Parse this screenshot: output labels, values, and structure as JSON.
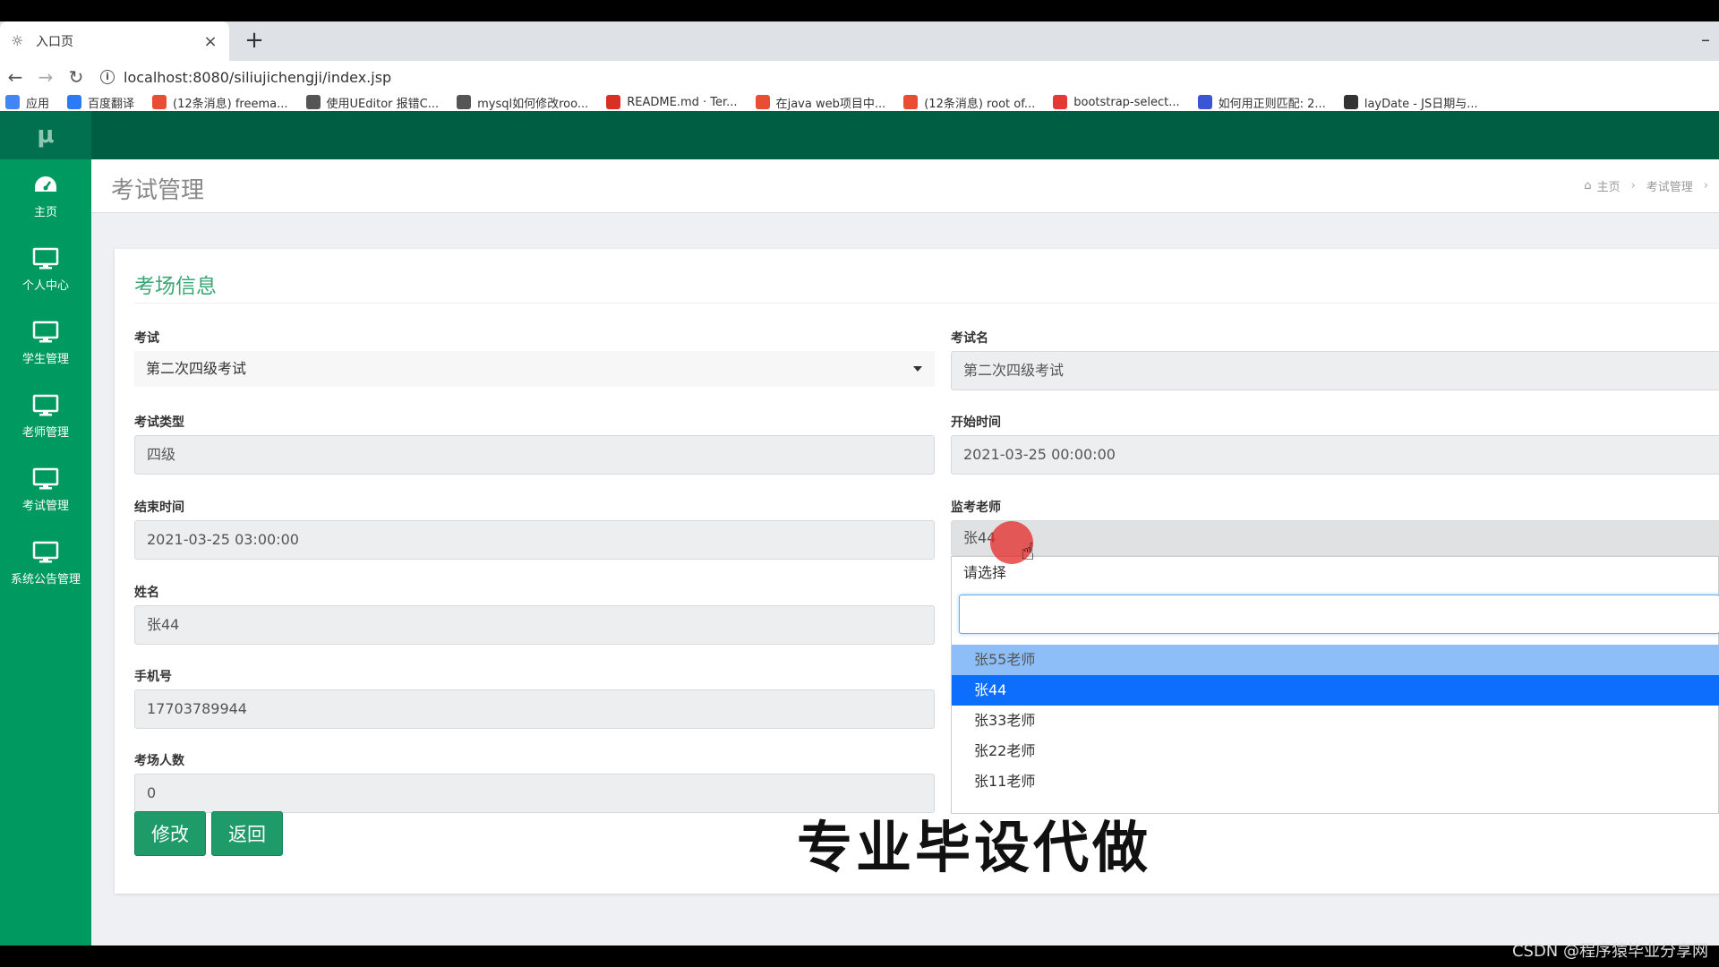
{
  "browser": {
    "tab_title": "入口页",
    "url": "localhost:8080/siliujichengji/index.jsp",
    "bookmarks": [
      {
        "label": "应用",
        "color": "#4285f4"
      },
      {
        "label": "百度翻译",
        "color": "#2b7bf7"
      },
      {
        "label": "(12条消息) freema...",
        "color": "#e94d33"
      },
      {
        "label": "使用UEditor 报错C...",
        "color": "#555555"
      },
      {
        "label": "mysql如何修改roo...",
        "color": "#555555"
      },
      {
        "label": "README.md · Ter...",
        "color": "#d93025"
      },
      {
        "label": "在java web项目中...",
        "color": "#e94d33"
      },
      {
        "label": "(12条消息) root of...",
        "color": "#e94d33"
      },
      {
        "label": "bootstrap-select...",
        "color": "#e53935"
      },
      {
        "label": "如何用正则匹配: 2...",
        "color": "#3a56d4"
      },
      {
        "label": "layDate - JS日期与...",
        "color": "#333333"
      }
    ]
  },
  "app": {
    "logo": "μ",
    "sidebar": [
      {
        "label": "主页"
      },
      {
        "label": "个人中心"
      },
      {
        "label": "学生管理"
      },
      {
        "label": "老师管理"
      },
      {
        "label": "考试管理"
      },
      {
        "label": "系统公告管理"
      }
    ],
    "page_title": "考试管理",
    "breadcrumb": {
      "home": "主页",
      "current": "考试管理"
    }
  },
  "form": {
    "title": "考场信息",
    "exam_label": "考试",
    "exam_value": "第二次四级考试",
    "exam_name_label": "考试名",
    "exam_name_value": "第二次四级考试",
    "exam_type_label": "考试类型",
    "exam_type_value": "四级",
    "start_time_label": "开始时间",
    "start_time_value": "2021-03-25 00:00:00",
    "end_time_label": "结束时间",
    "end_time_value": "2021-03-25 03:00:00",
    "teacher_label": "监考老师",
    "teacher_value": "张44",
    "name_label": "姓名",
    "name_value": "张44",
    "phone_label": "手机号",
    "phone_value": "17703789944",
    "count_label": "考场人数",
    "count_value": "0",
    "dropdown": {
      "header": "请选择",
      "options": [
        "张55老师",
        "张44",
        "张33老师",
        "张22老师",
        "张11老师"
      ],
      "hover_index": 0,
      "selected_index": 1
    },
    "edit_button": "修改",
    "back_button": "返回"
  },
  "overlay": {
    "bottom_text": "专业毕设代做",
    "watermark": "CSDN @程序猿毕业分享网"
  },
  "colors": {
    "topbar": "#005f43",
    "sidebar": "#00995f",
    "accent_title": "#3aa876",
    "button": "#1f9b6a",
    "dropdown_active": "#0d6efd",
    "dropdown_hover": "#8dbef7"
  }
}
